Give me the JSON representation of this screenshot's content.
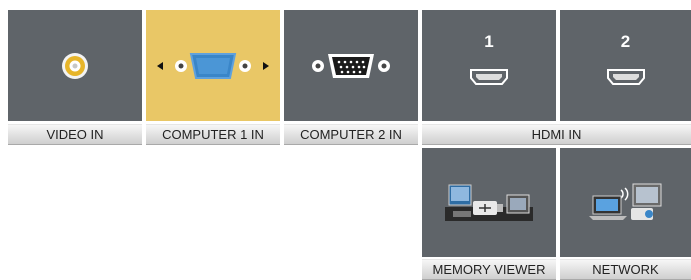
{
  "inputs": {
    "video": {
      "label": "VIDEO IN",
      "icon": "rca-jack-icon"
    },
    "computer1": {
      "label": "COMPUTER 1 IN",
      "icon": "vga-port-icon",
      "selected": true
    },
    "computer2": {
      "label": "COMPUTER 2 IN",
      "icon": "vga-port-icon"
    },
    "hdmi": {
      "label": "HDMI IN",
      "port1": "1",
      "port2": "2",
      "icon": "hdmi-port-icon"
    },
    "memory_viewer": {
      "label": "MEMORY VIEWER",
      "icon": "memory-viewer-icon"
    },
    "network": {
      "label": "NETWORK",
      "icon": "network-icon"
    }
  },
  "colors": {
    "tile": "#5f6469",
    "selected": "#e9c766",
    "connector_blue": "#3a86c8"
  }
}
